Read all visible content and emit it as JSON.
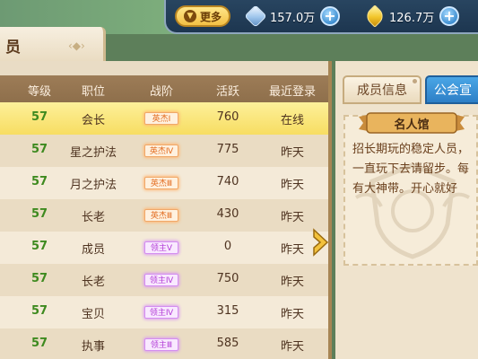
{
  "topbar": {
    "more_label": "更多",
    "crystal_value": "157.0万",
    "gold_value": "126.7万"
  },
  "panel": {
    "title": "员"
  },
  "table": {
    "headers": [
      "等级",
      "职位",
      "战阶",
      "活跃",
      "最近登录"
    ],
    "rows": [
      {
        "level": "57",
        "position": "会长",
        "rank": "英杰Ⅰ",
        "rank_type": "hero",
        "activity": "760",
        "last_login": "在线"
      },
      {
        "level": "57",
        "position": "星之护法",
        "rank": "英杰Ⅳ",
        "rank_type": "hero",
        "activity": "775",
        "last_login": "昨天"
      },
      {
        "level": "57",
        "position": "月之护法",
        "rank": "英杰Ⅲ",
        "rank_type": "hero",
        "activity": "740",
        "last_login": "昨天"
      },
      {
        "level": "57",
        "position": "长老",
        "rank": "英杰Ⅲ",
        "rank_type": "hero",
        "activity": "430",
        "last_login": "昨天"
      },
      {
        "level": "57",
        "position": "成员",
        "rank": "领主Ⅴ",
        "rank_type": "lord",
        "activity": "0",
        "last_login": "昨天"
      },
      {
        "level": "57",
        "position": "长老",
        "rank": "领主Ⅳ",
        "rank_type": "lord",
        "activity": "750",
        "last_login": "昨天"
      },
      {
        "level": "57",
        "position": "宝贝",
        "rank": "领主Ⅳ",
        "rank_type": "lord",
        "activity": "315",
        "last_login": "昨天"
      },
      {
        "level": "57",
        "position": "执事",
        "rank": "领主Ⅲ",
        "rank_type": "lord",
        "activity": "585",
        "last_login": "昨天"
      }
    ]
  },
  "right": {
    "tab_info": "成员信息",
    "tab_notice": "公会宣",
    "banner": "名人馆",
    "notice": "招长期玩的稳定人员，\n一直玩下去请留步。每\n有大神带。开心就好"
  },
  "icons": {
    "more_chevron": "chevron-down-icon",
    "crystal": "crystal-icon",
    "gold": "gold-leaf-icon",
    "plus": "plus-icon",
    "collapse": "chevron-right-icon"
  },
  "colors": {
    "selected_row": "#f7dd62",
    "level_text": "#3e8a1f",
    "hero_rank": "#e26a1d",
    "lord_rank": "#b23bd6",
    "tab_active": "#2d7fc6"
  }
}
